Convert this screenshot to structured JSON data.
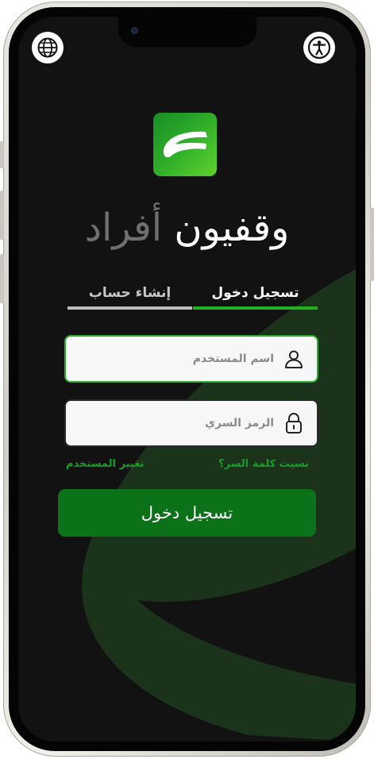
{
  "header": {
    "language_icon": "globe-icon",
    "accessibility_icon": "accessibility-icon"
  },
  "brand": {
    "logo_icon": "app-logo-icon",
    "name_part1": "وقفيون",
    "name_part2": "أفراد"
  },
  "tabs": {
    "login": "تسجيل دخول",
    "register": "إنشاء حساب"
  },
  "form": {
    "username_placeholder": "اسم المستخدم",
    "username_value": "",
    "password_placeholder": "الرمز السري",
    "password_value": "",
    "user_icon": "user-icon",
    "lock_icon": "lock-icon"
  },
  "links": {
    "forgot_password": "نسيت كلمة السر؟",
    "change_user": "تغيير المستخدم"
  },
  "submit_label": "تسجيل دخول",
  "colors": {
    "background": "#121212",
    "accent": "#21b121",
    "button": "#0c7219",
    "link": "#1b9a2a",
    "muted_text": "#6f6f6f"
  }
}
